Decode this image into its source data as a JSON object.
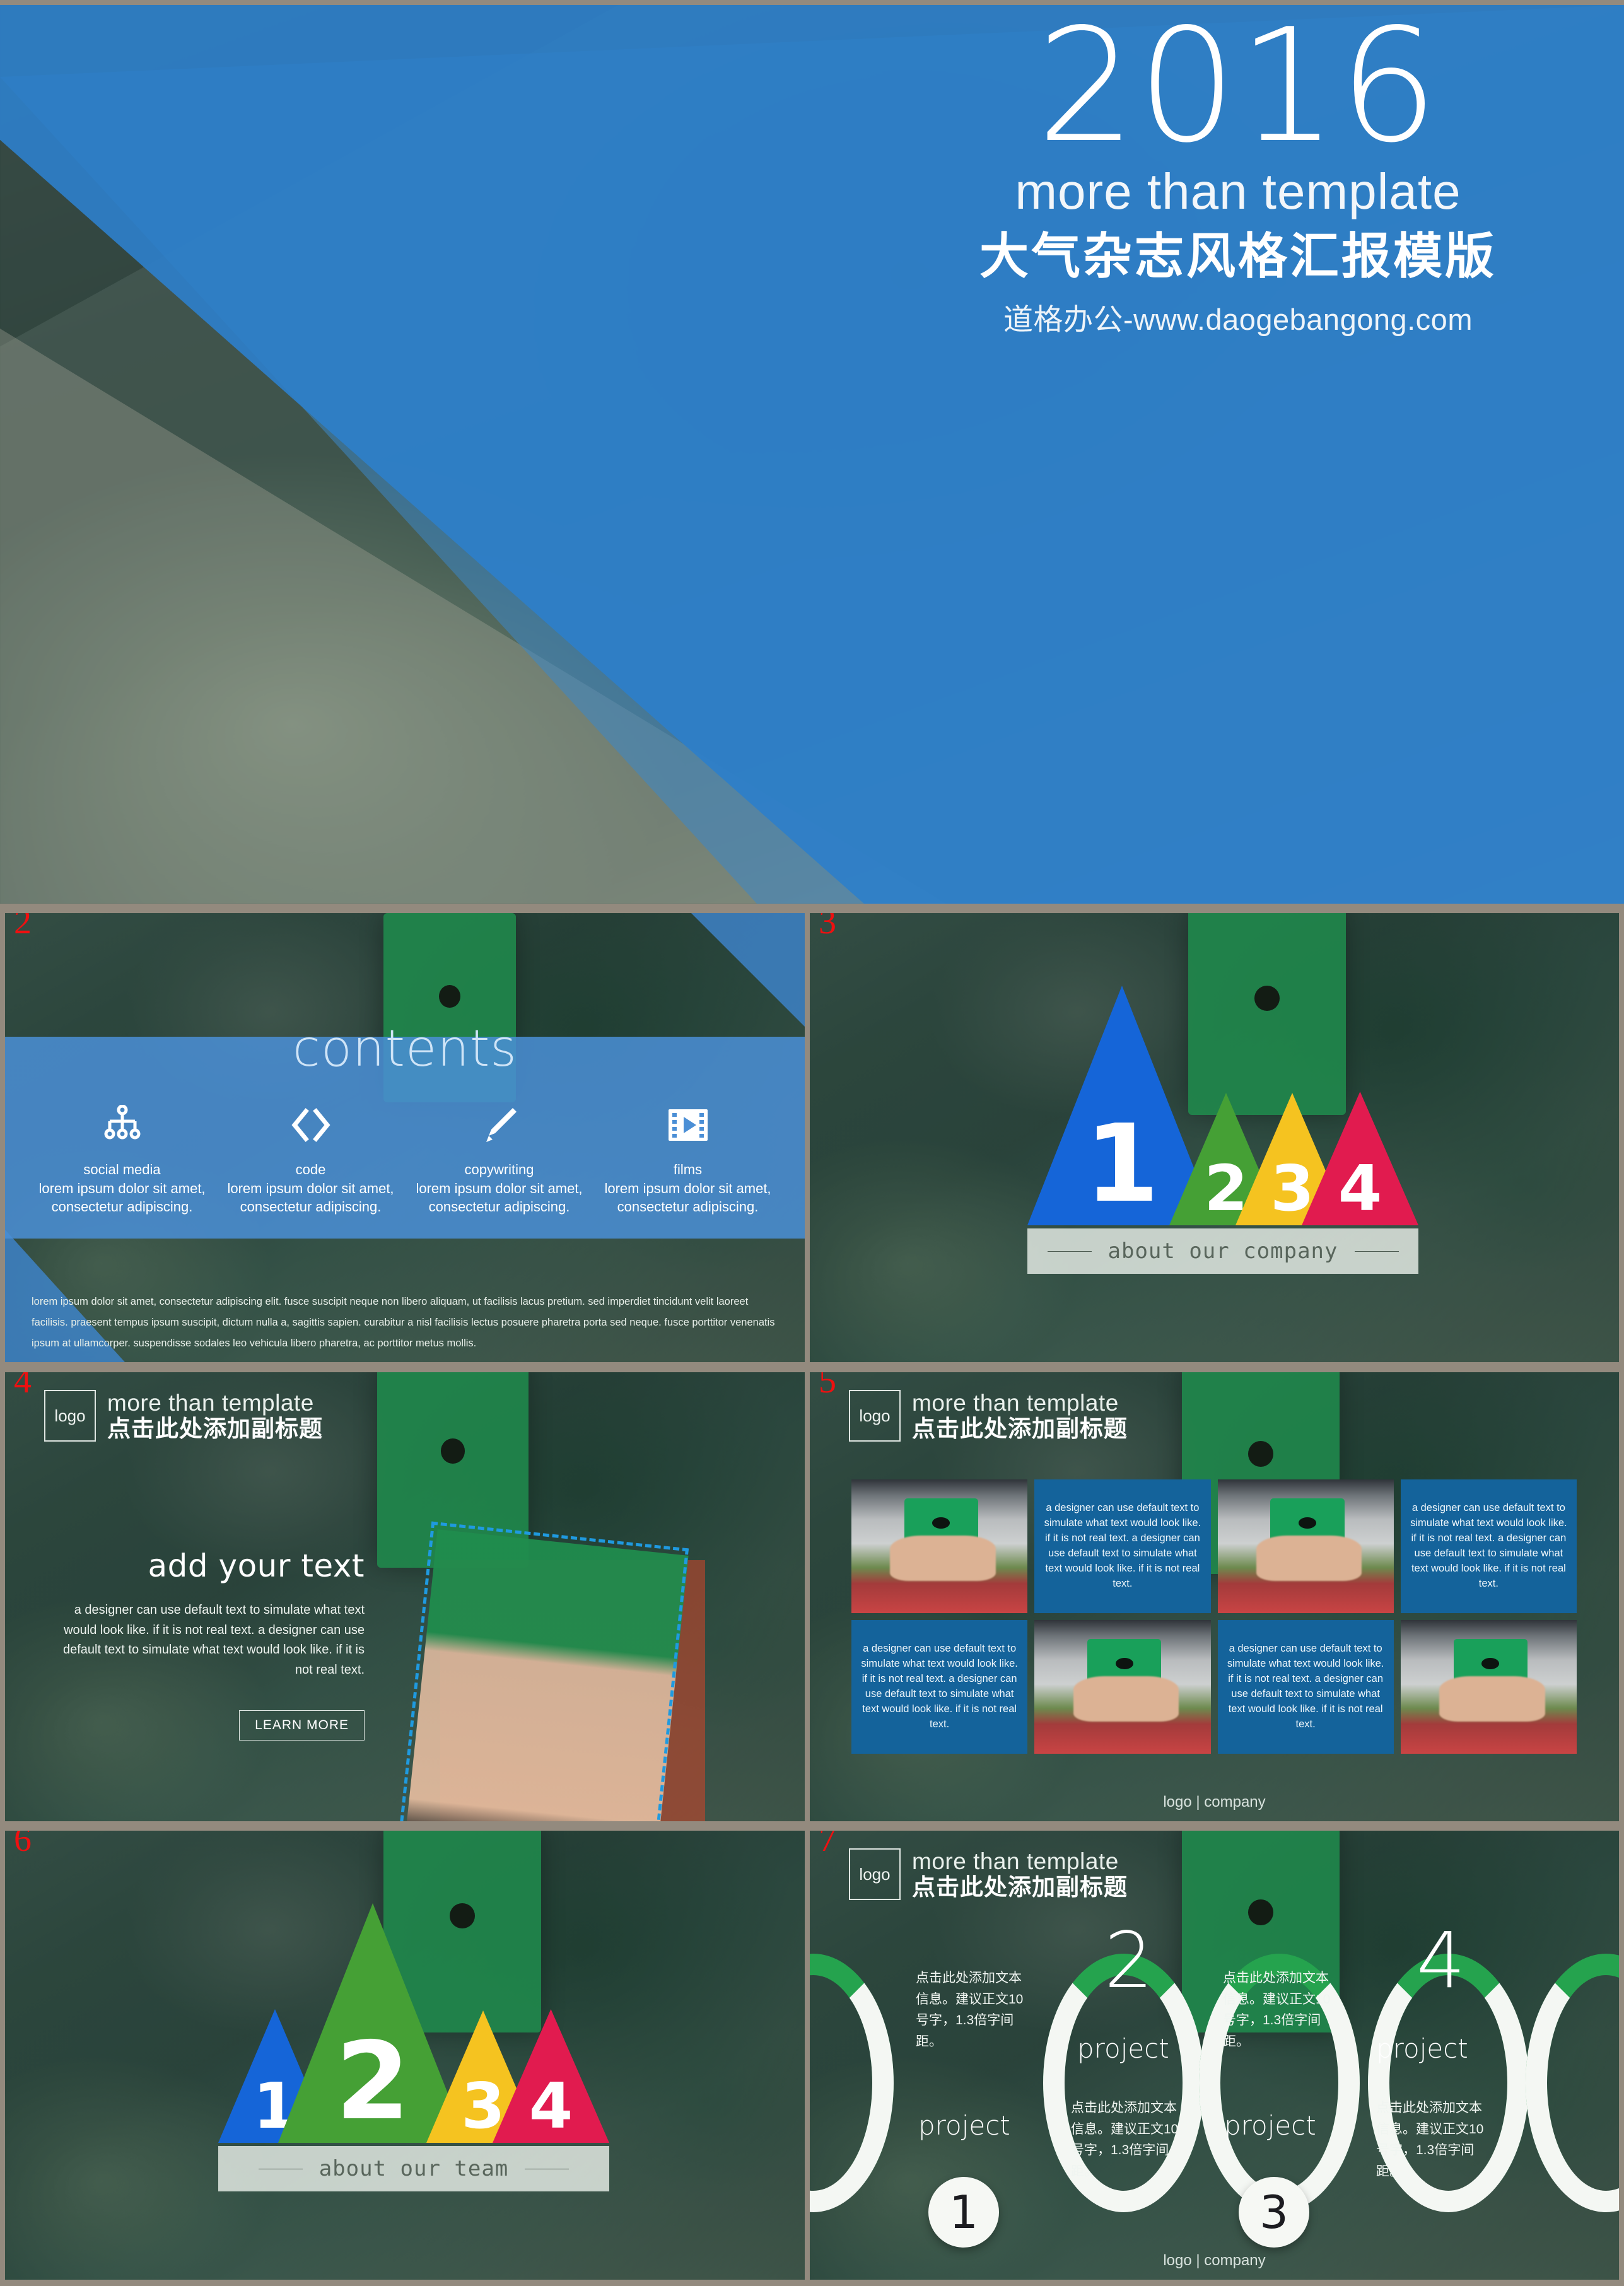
{
  "cover": {
    "year": "2016",
    "subtitle": "more than template",
    "cn_title": "大气杂志风格汇报模版",
    "url": "道格办公-www.daogebangong.com"
  },
  "slide_numbers": {
    "s2": "2",
    "s3": "3",
    "s4": "4",
    "s5": "5",
    "s6": "6",
    "s7": "7"
  },
  "header": {
    "logo": "logo",
    "line1": "more than template",
    "line2": "点击此处添加副标题",
    "footer": "logo | company"
  },
  "contents": {
    "title": "contents",
    "items": [
      {
        "icon": "sitemap-icon",
        "title": "social media",
        "body": "lorem ipsum dolor sit amet, consectetur adipiscing."
      },
      {
        "icon": "code-icon",
        "title": "code",
        "body": "lorem ipsum dolor sit amet, consectetur adipiscing."
      },
      {
        "icon": "pencil-icon",
        "title": "copywriting",
        "body": "lorem ipsum dolor sit amet, consectetur adipiscing."
      },
      {
        "icon": "film-play-icon",
        "title": "films",
        "body": "lorem ipsum dolor sit amet, consectetur adipiscing."
      }
    ],
    "paragraph": "lorem ipsum dolor sit amet, consectetur adipiscing elit. fusce suscipit neque non libero aliquam, ut facilisis lacus pretium. sed imperdiet tincidunt velit laoreet facilisis. praesent tempus ipsum suscipit, dictum nulla a, sagittis sapien. curabitur a nisl facilisis lectus posuere pharetra porta sed neque. fusce porttitor venenatis ipsum at ullamcorper. suspendisse sodales leo vehicula libero pharetra, ac porttitor metus mollis."
  },
  "section_company": {
    "bar_label": "about our company",
    "triangles": [
      {
        "label": "1",
        "color": "#1565d8"
      },
      {
        "label": "2",
        "color": "#45a035"
      },
      {
        "label": "3",
        "color": "#f5c320"
      },
      {
        "label": "4",
        "color": "#e11b4f"
      }
    ]
  },
  "section_team": {
    "bar_label": "about our team",
    "triangles": [
      {
        "label": "1",
        "color": "#1565d8"
      },
      {
        "label": "2",
        "color": "#45a035"
      },
      {
        "label": "3",
        "color": "#f5c320"
      },
      {
        "label": "4",
        "color": "#e11b4f"
      }
    ]
  },
  "slide4": {
    "heading": "add your text",
    "body": "a designer can use default text to simulate what text would look like. if it is not real text. a designer can use default text to simulate what text would look like. if it is not real text.",
    "button": "LEARN MORE"
  },
  "slide5": {
    "text_block": "a designer can use default text to simulate what text would look like. if it is not real text. a designer can use default text to simulate what text would look like. if it is not real text.",
    "cells": [
      "img",
      "txt",
      "img",
      "txt",
      "txt",
      "img",
      "txt",
      "img"
    ]
  },
  "slide7": {
    "steps": [
      {
        "number": "1",
        "big": "",
        "label": "project",
        "text": "点击此处添加文本信息。建议正文10号字，1.3倍字间距。"
      },
      {
        "number": "2",
        "big": "2",
        "label": "project",
        "text": "点击此处添加文本信息。建议正文10号字，1.3倍字间距。"
      },
      {
        "number": "3",
        "big": "",
        "label": "project",
        "text": "点击此处添加文本信息。建议正文10号字，1.3倍字间距。"
      },
      {
        "number": "4",
        "big": "4",
        "label": "project",
        "text": "点击此处添加文本信息。建议正文10号字，1.3倍字间距。"
      }
    ]
  },
  "colors": {
    "brand_blue": "#2e7fc9",
    "panel_blue": "#14639b",
    "accent_green": "#25a34e",
    "slide_number_red": "#ef1010"
  }
}
